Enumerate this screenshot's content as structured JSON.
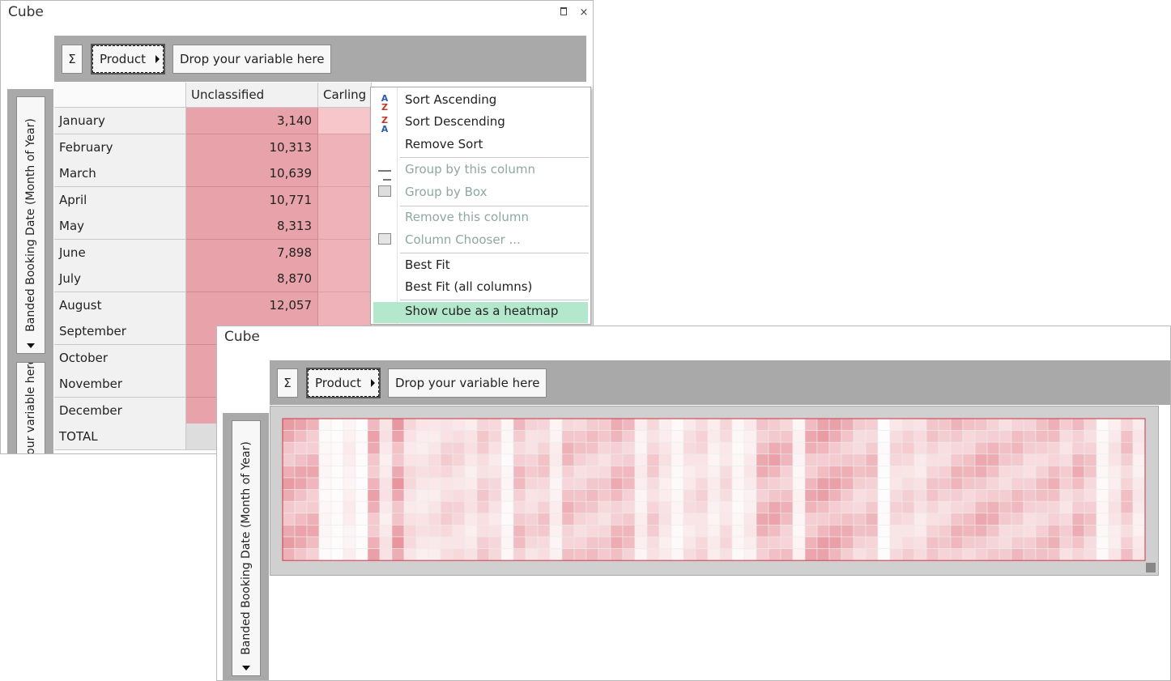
{
  "window1": {
    "title": "Cube",
    "pin_glyph": "📌",
    "close_glyph": "×",
    "toolbar": {
      "sigma": "Σ",
      "product_chip": "Product",
      "drop_zone": "Drop your variable here"
    },
    "row_axis_label": "Banded Booking Date (Month of Year)",
    "row_drop_zone": "Drop your variable here",
    "columns": [
      "Unclassified",
      "Carling"
    ],
    "rows": [
      {
        "label": "January",
        "value": "3,140"
      },
      {
        "label": "February",
        "value": "10,313"
      },
      {
        "label": "March",
        "value": "10,639"
      },
      {
        "label": "April",
        "value": "10,771"
      },
      {
        "label": "May",
        "value": "8,313"
      },
      {
        "label": "June",
        "value": "7,898"
      },
      {
        "label": "July",
        "value": "8,870"
      },
      {
        "label": "August",
        "value": "12,057"
      },
      {
        "label": "September",
        "value": ""
      },
      {
        "label": "October",
        "value": ""
      },
      {
        "label": "November",
        "value": ""
      },
      {
        "label": "December",
        "value": ""
      },
      {
        "label": "TOTAL",
        "value": ""
      }
    ],
    "context_menu": {
      "sort_ascending": "Sort Ascending",
      "sort_descending": "Sort Descending",
      "remove_sort": "Remove Sort",
      "group_by_column": "Group by this column",
      "group_by_box": "Group by Box",
      "remove_column": "Remove this column",
      "column_chooser": "Column Chooser ...",
      "best_fit": "Best Fit",
      "best_fit_all": "Best Fit (all columns)",
      "show_heatmap": "Show cube as a heatmap"
    }
  },
  "window2": {
    "title": "Cube",
    "toolbar": {
      "sigma": "Σ",
      "product_chip": "Product",
      "drop_zone": "Drop your variable here"
    },
    "row_axis_label": "Banded Booking Date (Month of Year)",
    "heatmap": {
      "rows": 12,
      "columns": 71,
      "high_color": "#e8959e",
      "low_color": "#ffffff"
    }
  },
  "colors": {
    "accent_highlight": "#b3e8cc",
    "cell_heat": "#e8a3aa",
    "toolbar_gray": "#a9a9a9"
  }
}
